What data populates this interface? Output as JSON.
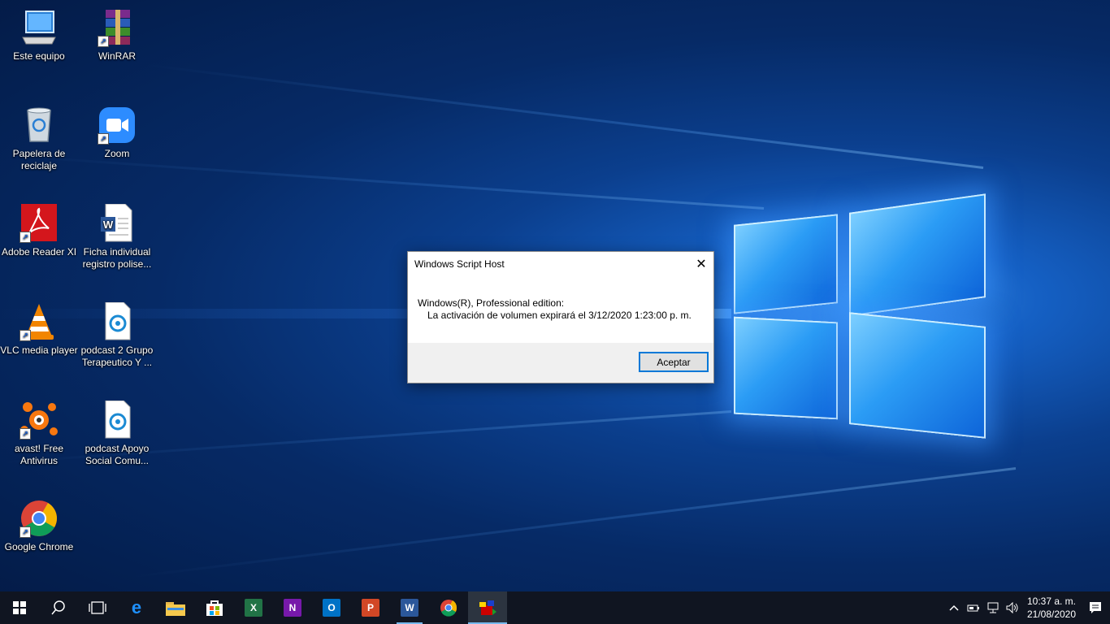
{
  "desktop": {
    "icons": [
      {
        "label": "Este equipo",
        "icon": "computer-icon"
      },
      {
        "label": "WinRAR",
        "icon": "winrar-icon"
      },
      {
        "label": "Papelera de reciclaje",
        "icon": "recycle-bin-icon"
      },
      {
        "label": "Zoom",
        "icon": "zoom-icon"
      },
      {
        "label": "Adobe Reader XI",
        "icon": "adobe-reader-icon"
      },
      {
        "label": "Ficha individual registro polise...",
        "icon": "word-document-icon"
      },
      {
        "label": "VLC media player",
        "icon": "vlc-icon"
      },
      {
        "label": "podcast 2 Grupo Terapeutico Y ...",
        "icon": "audio-file-icon"
      },
      {
        "label": "avast! Free Antivirus",
        "icon": "avast-icon"
      },
      {
        "label": "podcast Apoyo Social Comu...",
        "icon": "audio-file-icon"
      },
      {
        "label": "Google Chrome",
        "icon": "chrome-icon"
      }
    ]
  },
  "dialog": {
    "title": "Windows Script Host",
    "line1": "Windows(R), Professional edition:",
    "line2": "La activación de volumen expirará el 3/12/2020 1:23:00 p. m.",
    "ok_label": "Aceptar",
    "close_glyph": "✕"
  },
  "taskbar": {
    "apps": [
      "Microsoft Edge",
      "Explorador de archivos",
      "Microsoft Store",
      "Excel",
      "OneNote",
      "Outlook",
      "PowerPoint",
      "Word",
      "Google Chrome",
      "Windows Script Host"
    ],
    "time": "10:37 a. m.",
    "date": "21/08/2020",
    "accent": "#76b9ed"
  }
}
